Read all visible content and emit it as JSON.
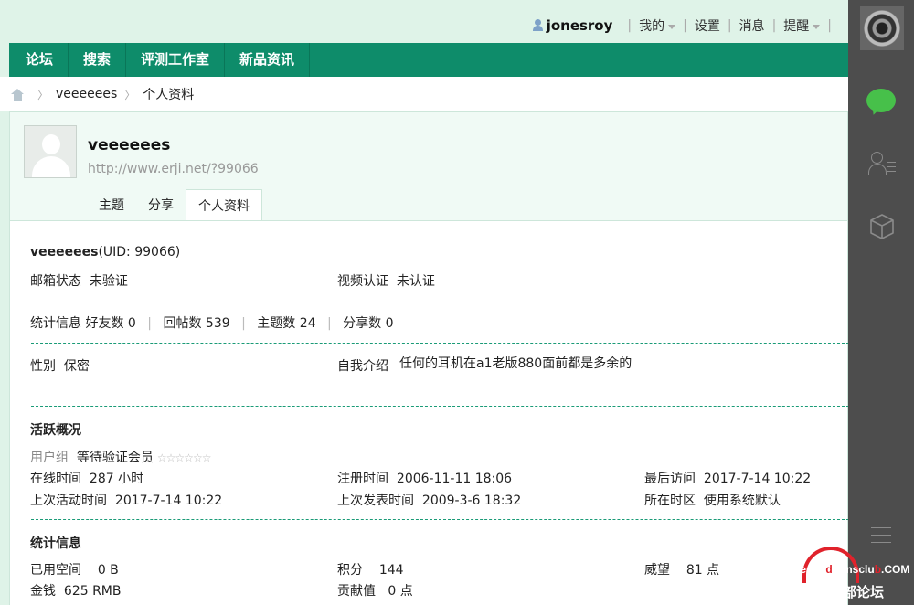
{
  "usernav": {
    "username": "jonesroy",
    "items": [
      "我的",
      "设置",
      "消息",
      "提醒"
    ]
  },
  "nav": {
    "items": [
      "论坛",
      "搜索",
      "评测工作室",
      "新品资讯"
    ]
  },
  "breadcrumb": {
    "current_user": "veeeeees",
    "page": "个人资料"
  },
  "profile": {
    "name": "veeeeees",
    "url": "http://www.erji.net/?99066",
    "tabs": [
      "主题",
      "分享",
      "个人资料"
    ],
    "active_tab": "个人资料"
  },
  "info": {
    "title_name": "veeeeees",
    "uid": "(UID: 99066)",
    "email_label": "邮箱状态",
    "email_value": "未验证",
    "video_label": "视频认证",
    "video_value": "未认证",
    "stats_label": "统计信息",
    "friends_label": "好友数",
    "friends": "0",
    "replies_label": "回帖数",
    "replies": "539",
    "threads_label": "主题数",
    "threads": "24",
    "shares_label": "分享数",
    "shares": "0",
    "gender_label": "性别",
    "gender_value": "保密",
    "bio_label": "自我介绍",
    "bio_value": "任何的耳机在a1老版880面前都是多余的"
  },
  "activity": {
    "heading": "活跃概况",
    "group_label": "用户组",
    "group_value": "等待验证会员",
    "group_stars": "☆☆☆☆☆☆",
    "online_label": "在线时间",
    "online_value": "287 小时",
    "reg_label": "注册时间",
    "reg_value": "2006-11-11 18:06",
    "last_visit_label": "最后访问",
    "last_visit_value": "2017-7-14 10:22",
    "last_active_label": "上次活动时间",
    "last_active_value": "2017-7-14 10:22",
    "last_post_label": "上次发表时间",
    "last_post_value": "2009-3-6 18:32",
    "tz_label": "所在时区",
    "tz_value": "使用系统默认"
  },
  "stats": {
    "heading": "统计信息",
    "space_label": "已用空间",
    "space_value": "0 B",
    "points_label": "积分",
    "points_value": "144",
    "prestige_label": "威望",
    "prestige_value": "81 点",
    "money_label": "金钱",
    "money_value": "625 RMB",
    "contrib_label": "贡献值",
    "contrib_value": "0 点"
  },
  "watermark": {
    "line1_a": "headp",
    "line1_b": "honsclu",
    "line1_c": "b.COM",
    "line2": "耳机俱乐部论坛"
  },
  "colors": {
    "nav_green": "#0e8c6a",
    "page_bg": "#dff3e8",
    "sidebar_dark": "#4d4d4d",
    "wechat_green": "#47c04a"
  }
}
